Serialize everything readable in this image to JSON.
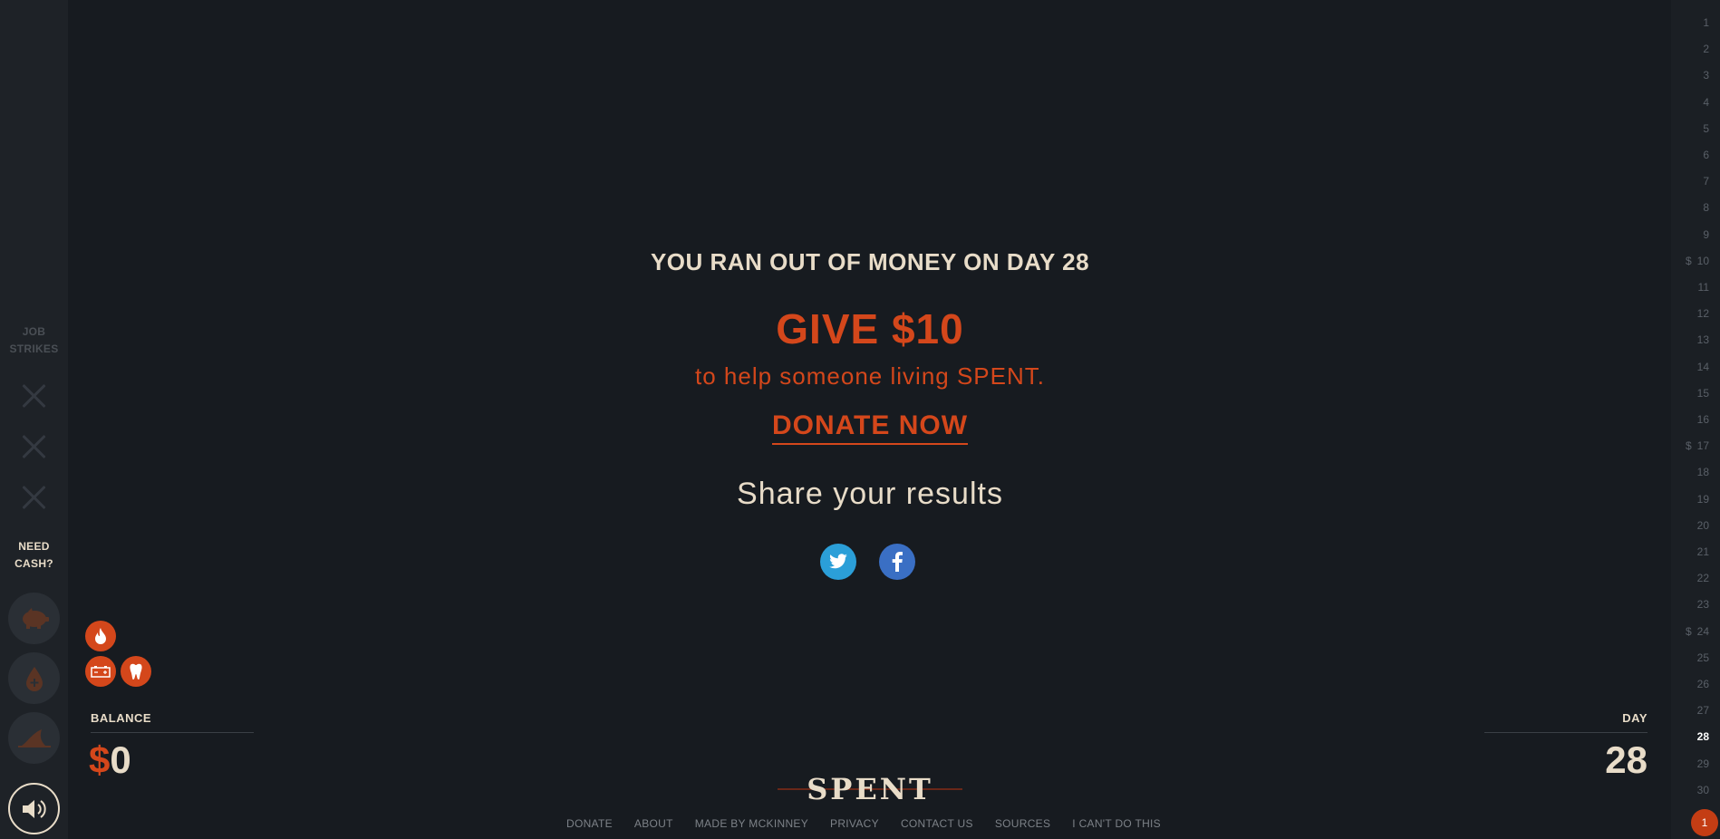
{
  "sidebar": {
    "job_strikes_label": "JOB STRIKES",
    "need_cash_label": "NEED CASH?",
    "strikes_count": 3,
    "cash_options": [
      "piggy-bank-icon",
      "blood-drop-icon",
      "shark-fin-icon"
    ],
    "sound_icon": "speaker-icon"
  },
  "message": {
    "headline": "YOU RAN OUT OF MONEY ON DAY 28",
    "give": "GIVE $10",
    "help": "to help someone living SPENT.",
    "donate": "DONATE NOW",
    "share": "Share your results"
  },
  "social": [
    "twitter-icon",
    "facebook-icon"
  ],
  "expenses": [
    "fire-icon",
    "car-battery-icon",
    "tooth-icon"
  ],
  "balance": {
    "label": "BALANCE",
    "currency": "$",
    "value": "0"
  },
  "day": {
    "label": "DAY",
    "value": "28"
  },
  "day_strip": {
    "days": [
      "1",
      "2",
      "3",
      "4",
      "5",
      "6",
      "7",
      "8",
      "9",
      "10",
      "11",
      "12",
      "13",
      "14",
      "15",
      "16",
      "17",
      "18",
      "19",
      "20",
      "21",
      "22",
      "23",
      "24",
      "25",
      "26",
      "27",
      "28",
      "29",
      "30"
    ],
    "paydays": [
      "10",
      "17",
      "24"
    ],
    "current": "28",
    "badge": "1"
  },
  "footer": {
    "logo": "SPENT",
    "links": [
      "DONATE",
      "ABOUT",
      "MADE BY MCKINNEY",
      "PRIVACY",
      "CONTACT US",
      "SOURCES",
      "I CAN'T DO THIS"
    ]
  },
  "colors": {
    "accent": "#d4471b",
    "text": "#e8dcc8",
    "background": "#171b20",
    "twitter": "#2b9fd8",
    "facebook": "#3a6fc4"
  }
}
